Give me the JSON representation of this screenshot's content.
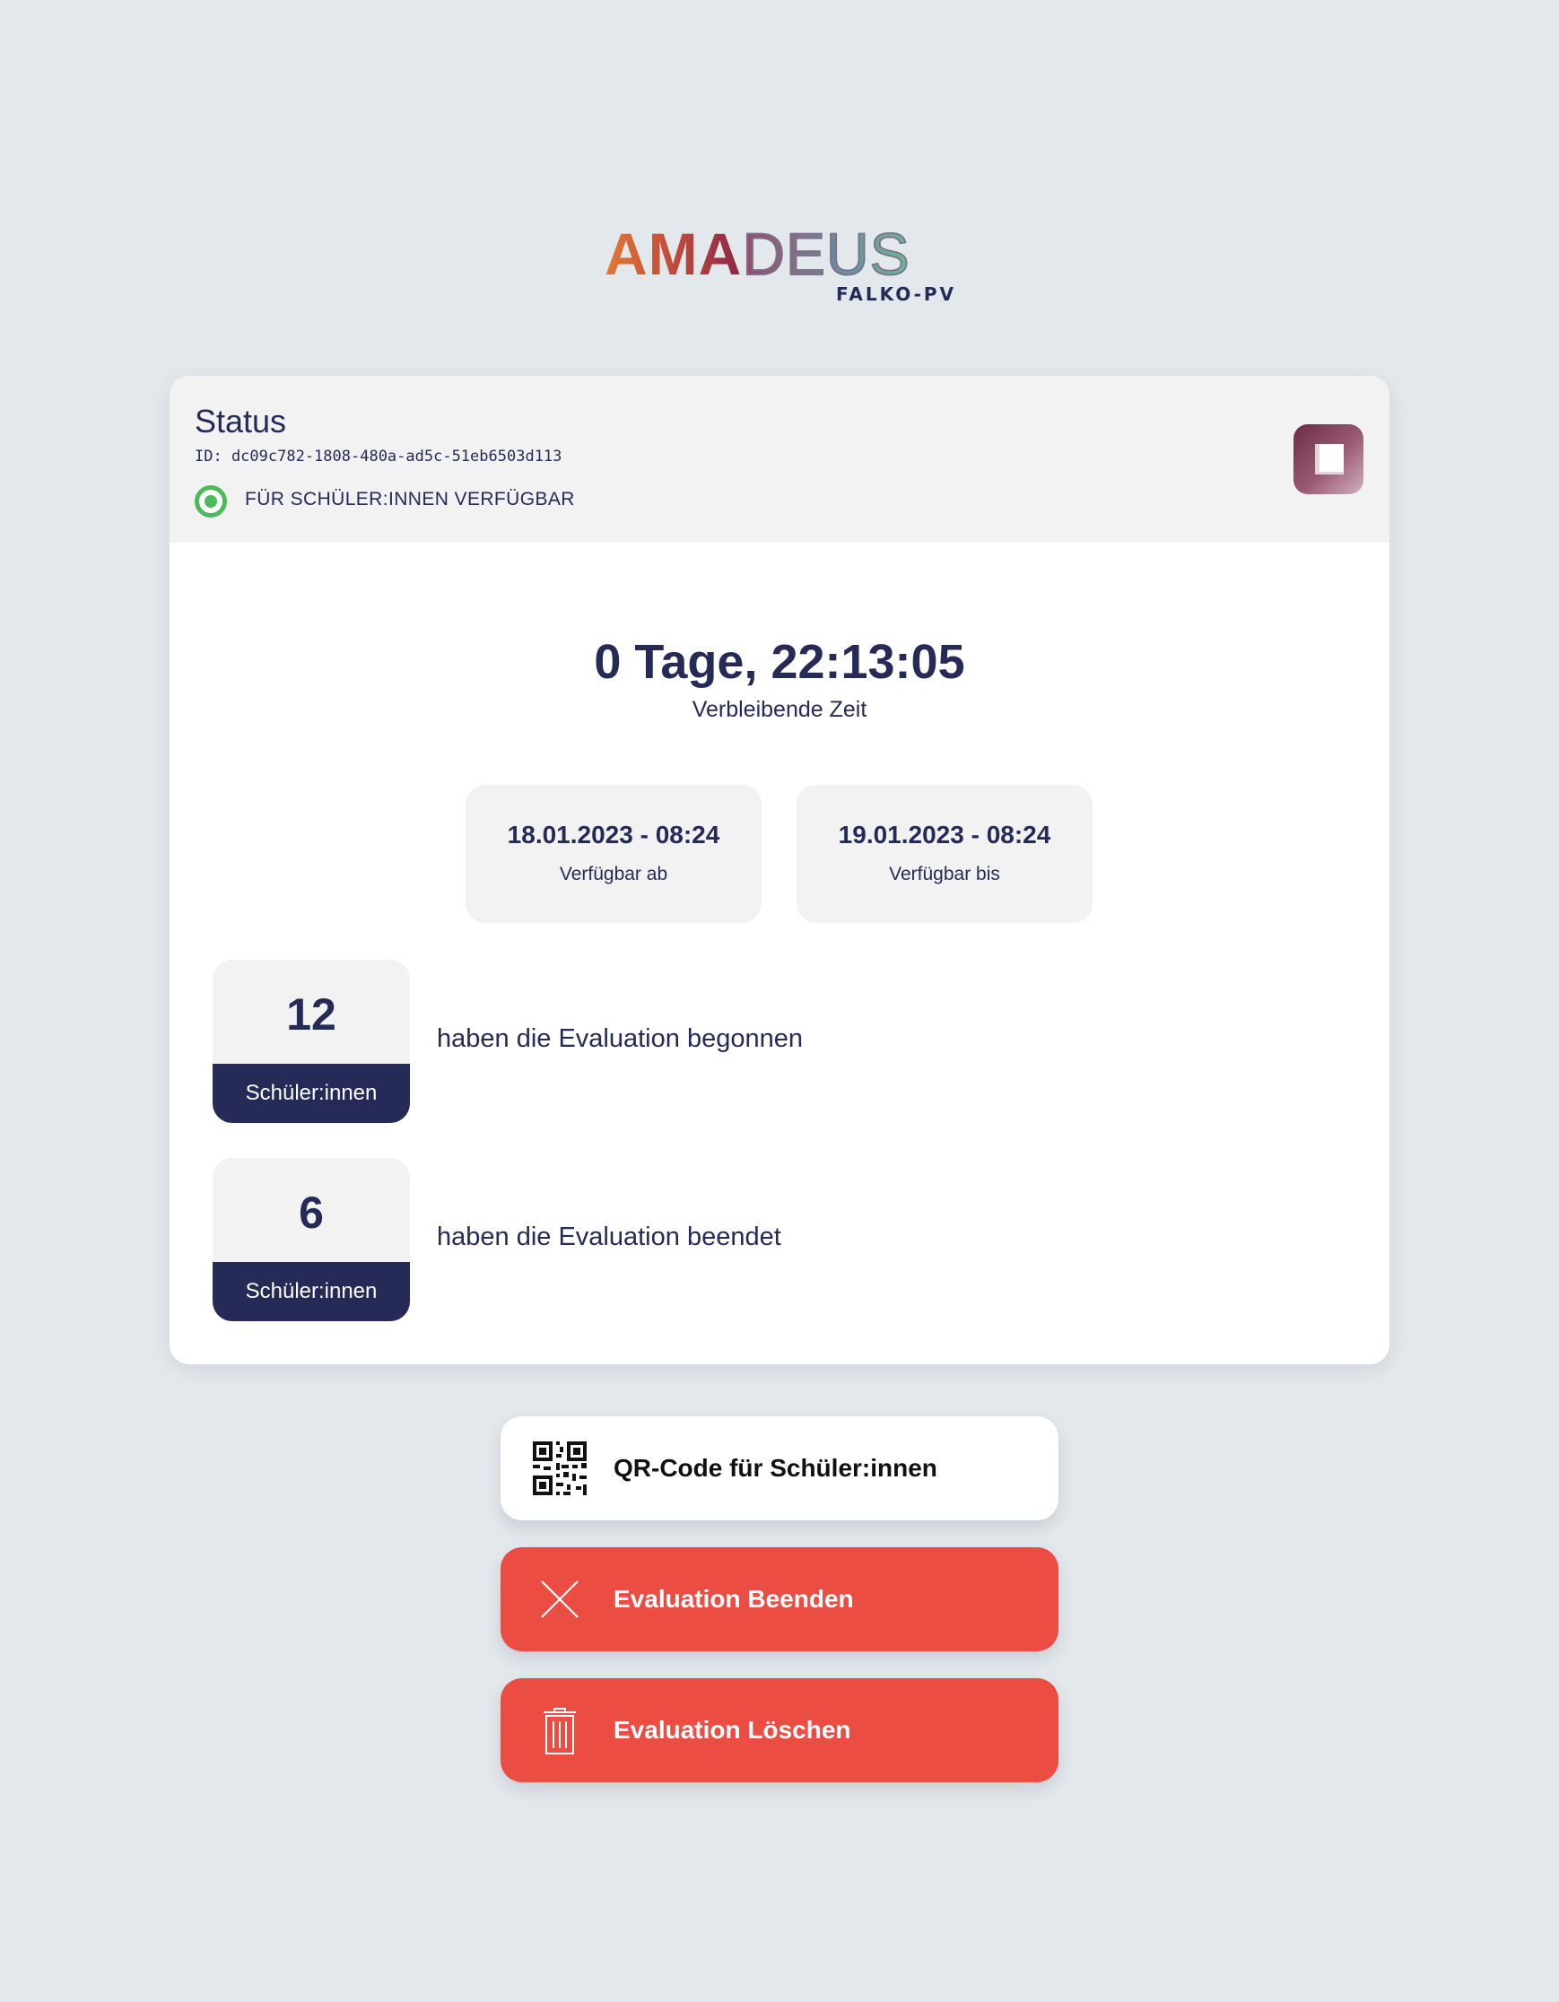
{
  "logo": {
    "word_bold": "AMA",
    "word_thin": "DEUS",
    "subtitle": "FALKO-PV"
  },
  "status": {
    "title": "Status",
    "id_text": "ID: dc09c782-1808-480a-ad5c-51eb6503d113",
    "availability": "FÜR SCHÜLER:INNEN VERFÜGBAR",
    "indicator_color": "#4cba5a",
    "stop_icon": "stop-icon"
  },
  "countdown": {
    "value": "0 Tage, 22:13:05",
    "label": "Verbleibende Zeit"
  },
  "availability_window": {
    "from_value": "18.01.2023 - 08:24",
    "from_label": "Verfügbar ab",
    "to_value": "19.01.2023 - 08:24",
    "to_label": "Verfügbar bis"
  },
  "stats": {
    "started": {
      "count": "12",
      "unit": "Schüler:innen",
      "description": "haben die Evaluation begonnen"
    },
    "finished": {
      "count": "6",
      "unit": "Schüler:innen",
      "description": "haben die Evaluation beendet"
    }
  },
  "actions": {
    "qr": {
      "label": "QR-Code für Schüler:innen",
      "icon": "qr-code-icon"
    },
    "end": {
      "label": "Evaluation Beenden",
      "icon": "close-icon"
    },
    "delete": {
      "label": "Evaluation Löschen",
      "icon": "trash-icon"
    }
  },
  "colors": {
    "background": "#e3e8ec",
    "navy": "#252a56",
    "danger": "#eb4d43",
    "success": "#4cba5a"
  }
}
